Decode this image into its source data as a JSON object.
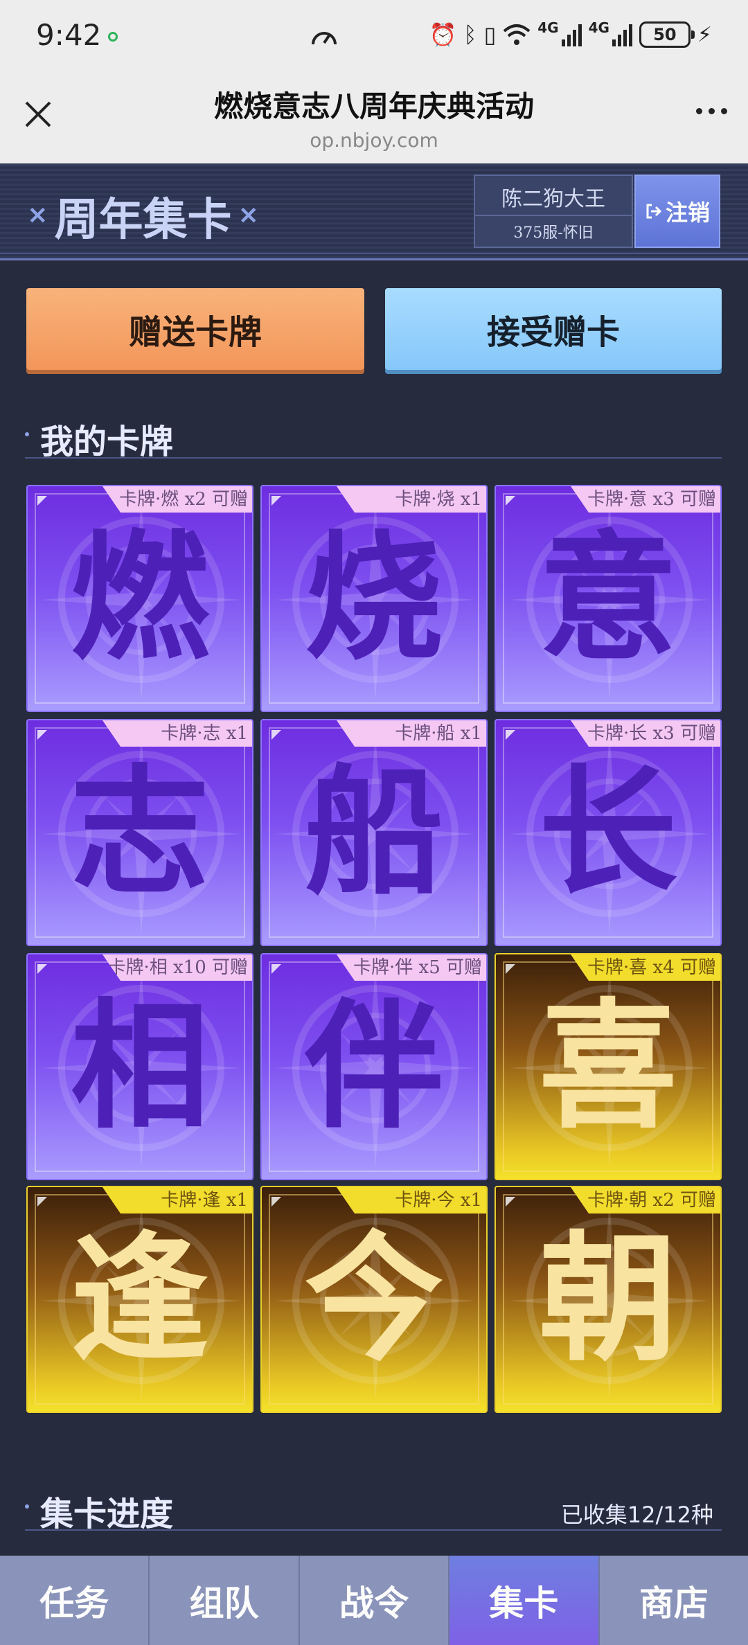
{
  "status_bar": {
    "time": "9:42",
    "network_1": "4G",
    "network_2": "4G",
    "battery": "50"
  },
  "title_bar": {
    "title": "燃烧意志八周年庆典活动",
    "url": "op.nbjoy.com"
  },
  "banner": {
    "title": "周年集卡",
    "user_name": "陈二狗大王",
    "server": "375服-怀旧",
    "logout_label": "注销"
  },
  "actions": {
    "gift_label": "赠送卡牌",
    "receive_label": "接受赠卡"
  },
  "my_cards": {
    "heading": "我的卡牌",
    "cards": [
      {
        "glyph": "燃",
        "tag": "卡牌·燃 x2 可赠",
        "style": "purple"
      },
      {
        "glyph": "烧",
        "tag": "卡牌·烧 x1",
        "style": "purple"
      },
      {
        "glyph": "意",
        "tag": "卡牌·意 x3 可赠",
        "style": "purple"
      },
      {
        "glyph": "志",
        "tag": "卡牌·志 x1",
        "style": "purple"
      },
      {
        "glyph": "船",
        "tag": "卡牌·船 x1",
        "style": "purple"
      },
      {
        "glyph": "长",
        "tag": "卡牌·长 x3 可赠",
        "style": "purple"
      },
      {
        "glyph": "相",
        "tag": "卡牌·相 x10 可赠",
        "style": "purple"
      },
      {
        "glyph": "伴",
        "tag": "卡牌·伴 x5 可赠",
        "style": "purple"
      },
      {
        "glyph": "喜",
        "tag": "卡牌·喜 x4 可赠",
        "style": "gold"
      },
      {
        "glyph": "逢",
        "tag": "卡牌·逢 x1",
        "style": "gold"
      },
      {
        "glyph": "今",
        "tag": "卡牌·今 x1",
        "style": "gold"
      },
      {
        "glyph": "朝",
        "tag": "卡牌·朝 x2 可赠",
        "style": "gold"
      }
    ]
  },
  "progress": {
    "heading": "集卡进度",
    "collected": "已收集12/12种"
  },
  "bottom_nav": {
    "items": [
      {
        "label": "任务",
        "active": false
      },
      {
        "label": "组队",
        "active": false
      },
      {
        "label": "战令",
        "active": false
      },
      {
        "label": "集卡",
        "active": true
      },
      {
        "label": "商店",
        "active": false
      }
    ]
  },
  "colors": {
    "accent": "#7e61e6",
    "gift_button": "#f3965b",
    "receive_button": "#86c7fb",
    "card_purple": "#6e2de0",
    "card_gold": "#e9c825"
  }
}
